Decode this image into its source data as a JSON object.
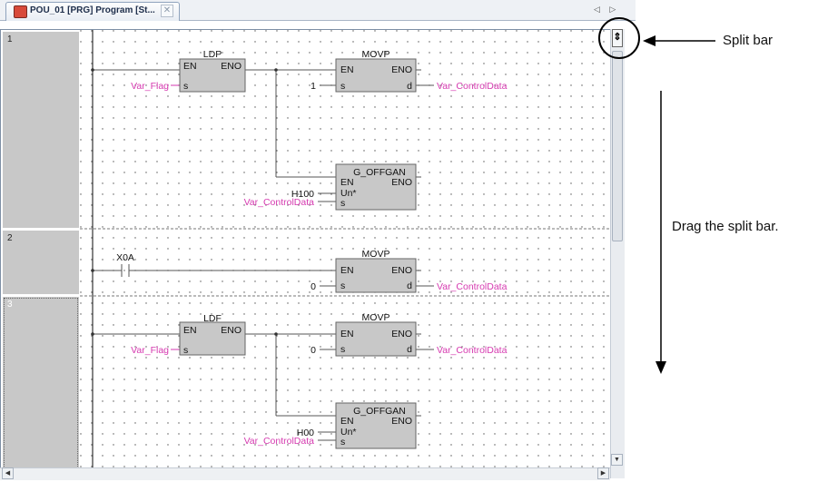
{
  "tab": {
    "title": "POU_01 [PRG] Program [St...",
    "close_glyph": "✕"
  },
  "tab_nav": "◁ ▷",
  "rungs": [
    {
      "number": "1"
    },
    {
      "number": "2"
    },
    {
      "number": "3"
    }
  ],
  "blocks": {
    "r1_ldp": {
      "name": "LDP",
      "en": "EN",
      "eno": "ENO",
      "s": "s"
    },
    "r1_movp": {
      "name": "MOVP",
      "en": "EN",
      "eno": "ENO",
      "s": "s",
      "d": "d"
    },
    "r1_goff": {
      "name": "G_OFFGAN",
      "en": "EN",
      "eno": "ENO",
      "un": "Un*",
      "s": "s"
    },
    "r2_movp": {
      "name": "MOVP",
      "en": "EN",
      "eno": "ENO",
      "s": "s",
      "d": "d"
    },
    "r3_ldf": {
      "name": "LDF",
      "en": "EN",
      "eno": "ENO",
      "s": "s"
    },
    "r3_movp": {
      "name": "MOVP",
      "en": "EN",
      "eno": "ENO",
      "s": "s",
      "d": "d"
    },
    "r3_goff": {
      "name": "G_OFFGAN",
      "en": "EN",
      "eno": "ENO",
      "un": "Un*",
      "s": "s"
    }
  },
  "operands": {
    "r1_flag": "Var_Flag",
    "r1_const": "1",
    "r1_dest": "Var_ControlData",
    "r1_hex": "H100",
    "r1_ctrl": "Var_ControlData",
    "r2_contact": "X0A",
    "r2_const": "0",
    "r2_dest": "Var_ControlData",
    "r3_flag": "Var_Flag",
    "r3_const": "0",
    "r3_dest": "Var_ControlData",
    "r3_hex": "H00",
    "r3_ctrl": "Var_ControlData"
  },
  "annotations": {
    "split_bar": "Split bar",
    "drag_hint": "Drag the split bar."
  },
  "colors": {
    "variable": "#d63ab0",
    "block_fill": "#c8c8c8",
    "wire": "#333333"
  }
}
